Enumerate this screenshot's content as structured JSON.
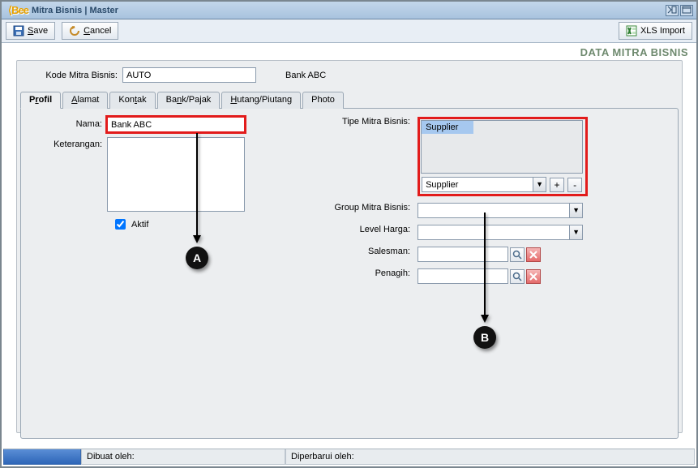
{
  "window": {
    "logo_lead": "⟨",
    "logo": "Bee",
    "title": "Mitra Bisnis | Master"
  },
  "toolbar": {
    "save_label": "Save",
    "cancel_label": "Cancel",
    "xls_label": "XLS Import"
  },
  "section_title": "DATA MITRA BISNIS",
  "header": {
    "kode_label": "Kode Mitra Bisnis:",
    "kode_value": "AUTO",
    "name_display": "Bank ABC"
  },
  "tabs": [
    "Profil",
    "Alamat",
    "Kontak",
    "Bank/Pajak",
    "Hutang/Piutang",
    "Photo"
  ],
  "tabs_active_index": 0,
  "profil": {
    "nama_label": "Nama:",
    "nama_value": "Bank ABC",
    "keterangan_label": "Keterangan:",
    "keterangan_value": "",
    "aktif_label": "Aktif",
    "aktif_checked": true
  },
  "right": {
    "tipe_label": "Tipe Mitra Bisnis:",
    "tipe_list": [
      "Supplier"
    ],
    "tipe_combo_value": "Supplier",
    "plus": "+",
    "minus": "-",
    "group_label": "Group Mitra Bisnis:",
    "group_value": "",
    "level_label": "Level Harga:",
    "level_value": "",
    "salesman_label": "Salesman:",
    "salesman_value": "",
    "penagih_label": "Penagih:",
    "penagih_value": ""
  },
  "callouts": {
    "a": "A",
    "b": "B"
  },
  "status": {
    "dibuat_label": "Dibuat oleh:",
    "diperbarui_label": "Diperbarui oleh:"
  }
}
